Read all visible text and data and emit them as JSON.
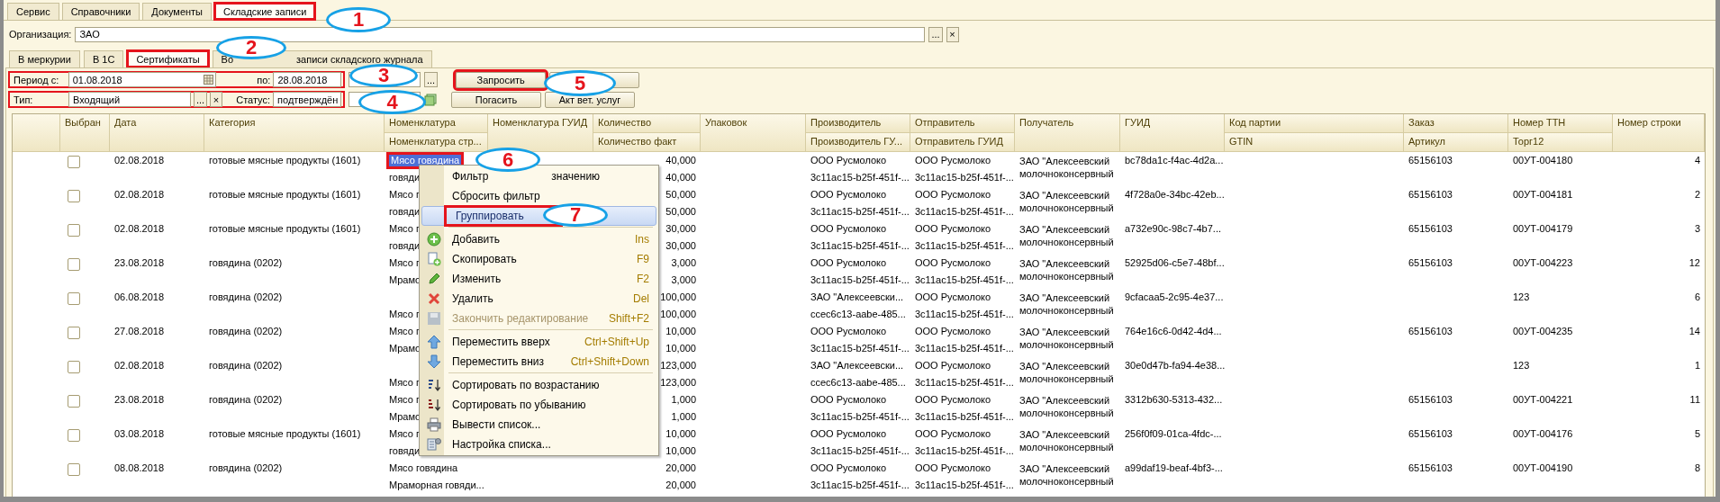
{
  "top_tabs": [
    {
      "label": "Сервис",
      "selected": false,
      "highlighted": false
    },
    {
      "label": "Справочники",
      "selected": false,
      "highlighted": false
    },
    {
      "label": "Документы",
      "selected": false,
      "highlighted": false
    },
    {
      "label": "Складские записи",
      "selected": true,
      "highlighted": true
    }
  ],
  "organization": {
    "label": "Организация:",
    "value": "ЗАО",
    "choose_button": "...",
    "clear_button": "×"
  },
  "sub_tabs": [
    {
      "label": "В меркурии",
      "selected": false,
      "highlighted": false
    },
    {
      "label": "В 1С",
      "selected": false,
      "highlighted": false
    },
    {
      "label": "Сертификаты",
      "selected": true,
      "highlighted": true
    },
    {
      "label": "Во",
      "label_end": "записи складского журнала",
      "selected": false,
      "highlighted": false
    }
  ],
  "period_filter": {
    "highlighted": true,
    "from_label": "Период с:",
    "from_value": "01.08.2018",
    "to_label": "по:",
    "to_value": "28.08.2018",
    "extra_button": "..."
  },
  "type_filter": {
    "highlighted": true,
    "type_label": "Тип:",
    "type_value": "Входящий",
    "choose_button": "...",
    "clear_button": "×",
    "status_label": "Статус:",
    "status_value": "подтверждён"
  },
  "buttons_row_1": [
    {
      "kind": "text",
      "label": "Запросить",
      "highlighted": true
    },
    {
      "kind": "blank",
      "highlighted": false
    }
  ],
  "buttons_row_2": [
    {
      "kind": "text",
      "label": "Погасить",
      "highlighted": false
    },
    {
      "kind": "text",
      "label": "Акт вет. услуг",
      "highlighted": false
    }
  ],
  "table": {
    "columns": [
      {
        "title": "Выбран"
      },
      {
        "title": "Дата"
      },
      {
        "title": "Категория"
      },
      {
        "title": "Номенклатура",
        "subtitle": "Номенклатура стр..."
      },
      {
        "title": "Номенклатура ГУИД"
      },
      {
        "title": "Количество",
        "subtitle": "Количество факт"
      },
      {
        "title": "Упаковок"
      },
      {
        "title": "Производитель",
        "subtitle": "Производитель ГУ..."
      },
      {
        "title": "Отправитель",
        "subtitle": "Отправитель ГУИД"
      },
      {
        "title": "Получатель"
      },
      {
        "title": "ГУИД"
      },
      {
        "title": "Код партии",
        "subtitle": "GTIN"
      },
      {
        "title": "Заказ",
        "subtitle": "Артикул"
      },
      {
        "title": "Номер ТТН",
        "subtitle": "Торг12"
      },
      {
        "title": "Номер строки"
      }
    ],
    "rows": [
      {
        "checked": false,
        "date": "02.08.2018",
        "category": "готовые мясные продукты (1601)",
        "nomenclature": {
          "top": "Мясо говядина",
          "bottom": "говяди",
          "selected": true,
          "highlighted": true
        },
        "quantity": [
          "40,000",
          "40,000"
        ],
        "producer": [
          "ООО Русмолоко",
          "3c11ac15-b25f-451f-..."
        ],
        "sender": [
          "ООО Русмолоко",
          "3c11ac15-b25f-451f-..."
        ],
        "recipient": "ЗАО \"Алексеевский молочноконсервный",
        "guid": "bc78da1c-f4ac-4d2a...",
        "order": "65156103",
        "ttn": "00УТ-004180",
        "line_no": "4"
      },
      {
        "checked": false,
        "date": "02.08.2018",
        "category": "готовые мясные продукты (1601)",
        "nomenclature": {
          "top": "Мясо г",
          "bottom": "говяди",
          "selected": false,
          "highlighted": false
        },
        "quantity": [
          "50,000",
          "50,000"
        ],
        "producer": [
          "ООО Русмолоко",
          "3c11ac15-b25f-451f-..."
        ],
        "sender": [
          "ООО Русмолоко",
          "3c11ac15-b25f-451f-..."
        ],
        "recipient": "ЗАО \"Алексеевский молочноконсервный",
        "guid": "4f728a0e-34bc-42eb...",
        "order": "65156103",
        "ttn": "00УТ-004181",
        "line_no": "2"
      },
      {
        "checked": false,
        "date": "02.08.2018",
        "category": "готовые мясные продукты (1601)",
        "nomenclature": {
          "top": "Мясо г",
          "bottom": "говяди",
          "selected": false,
          "highlighted": false
        },
        "quantity": [
          "30,000",
          "30,000"
        ],
        "producer": [
          "ООО Русмолоко",
          "3c11ac15-b25f-451f-..."
        ],
        "sender": [
          "ООО Русмолоко",
          "3c11ac15-b25f-451f-..."
        ],
        "recipient": "ЗАО \"Алексеевский молочноконсервный",
        "guid": "a732e90c-98c7-4b7...",
        "order": "65156103",
        "ttn": "00УТ-004179",
        "line_no": "3"
      },
      {
        "checked": false,
        "date": "23.08.2018",
        "category": "говядина (0202)",
        "nomenclature": {
          "top": "Мясо г",
          "bottom": "Мрамо",
          "selected": false,
          "highlighted": false
        },
        "quantity": [
          "3,000",
          "3,000"
        ],
        "producer": [
          "ООО Русмолоко",
          "3c11ac15-b25f-451f-..."
        ],
        "sender": [
          "ООО Русмолоко",
          "3c11ac15-b25f-451f-..."
        ],
        "recipient": "ЗАО \"Алексеевский молочноконсервный",
        "guid": "52925d06-c5e7-48bf...",
        "order": "65156103",
        "ttn": "00УТ-004223",
        "line_no": "12"
      },
      {
        "checked": false,
        "date": "06.08.2018",
        "category": "говядина (0202)",
        "nomenclature": {
          "bottom": "Мясо г",
          "selected": false,
          "highlighted": false
        },
        "quantity": [
          "100,000",
          "100,000"
        ],
        "producer": [
          "ЗАО \"Алексеевски...",
          "ccec6c13-aabe-485..."
        ],
        "sender": [
          "ООО Русмолоко",
          "3c11ac15-b25f-451f-..."
        ],
        "recipient": "ЗАО \"Алексеевский молочноконсервный",
        "guid": "9cfacaa5-2c95-4e37...",
        "ttn": "123",
        "line_no": "6"
      },
      {
        "checked": false,
        "date": "27.08.2018",
        "category": "говядина (0202)",
        "nomenclature": {
          "top": "Мясо г",
          "bottom": "Мрамо",
          "selected": false,
          "highlighted": false
        },
        "quantity": [
          "10,000",
          "10,000"
        ],
        "producer": [
          "ООО Русмолоко",
          "3c11ac15-b25f-451f-..."
        ],
        "sender": [
          "ООО Русмолоко",
          "3c11ac15-b25f-451f-..."
        ],
        "recipient": "ЗАО \"Алексеевский молочноконсервный",
        "guid": "764e16c6-0d42-4d4...",
        "order": "65156103",
        "ttn": "00УТ-004235",
        "line_no": "14"
      },
      {
        "checked": false,
        "date": "02.08.2018",
        "category": "говядина (0202)",
        "nomenclature": {
          "bottom": "Мясо г",
          "selected": false,
          "highlighted": false
        },
        "quantity": [
          "123,000",
          "123,000"
        ],
        "producer": [
          "ЗАО \"Алексеевски...",
          "ccec6c13-aabe-485..."
        ],
        "sender": [
          "ООО Русмолоко",
          "3c11ac15-b25f-451f-..."
        ],
        "recipient": "ЗАО \"Алексеевский молочноконсервный",
        "guid": "30e0d47b-fa94-4e38...",
        "ttn": "123",
        "line_no": "1"
      },
      {
        "checked": false,
        "date": "23.08.2018",
        "category": "говядина (0202)",
        "nomenclature": {
          "top": "Мясо г",
          "bottom": "Мрамо",
          "selected": false,
          "highlighted": false
        },
        "quantity": [
          "1,000",
          "1,000"
        ],
        "producer": [
          "ООО Русмолоко",
          "3c11ac15-b25f-451f-..."
        ],
        "sender": [
          "ООО Русмолоко",
          "3c11ac15-b25f-451f-..."
        ],
        "recipient": "ЗАО \"Алексеевский молочноконсервный",
        "guid": "3312b630-5313-432...",
        "order": "65156103",
        "ttn": "00УТ-004221",
        "line_no": "11"
      },
      {
        "checked": false,
        "date": "03.08.2018",
        "category": "готовые мясные продукты (1601)",
        "nomenclature": {
          "top": "Мясо г",
          "bottom": "говяди",
          "selected": false,
          "highlighted": false
        },
        "quantity": [
          "10,000",
          "10,000"
        ],
        "producer": [
          "ООО Русмолоко",
          "3c11ac15-b25f-451f-..."
        ],
        "sender": [
          "ООО Русмолоко",
          "3c11ac15-b25f-451f-..."
        ],
        "recipient": "ЗАО \"Алексеевский молочноконсервный",
        "guid": "256f0f09-01ca-4fdc-...",
        "order": "65156103",
        "ttn": "00УТ-004176",
        "line_no": "5"
      },
      {
        "checked": false,
        "date": "08.08.2018",
        "category": "говядина (0202)",
        "nomenclature": {
          "top": "Мясо говядина",
          "bottom": "Мраморная говяди...",
          "selected": false,
          "highlighted": false
        },
        "quantity": [
          "20,000",
          "20,000"
        ],
        "producer": [
          "ООО Русмолоко",
          "3c11ac15-b25f-451f-..."
        ],
        "sender": [
          "ООО Русмолоко",
          "3c11ac15-b25f-451f-..."
        ],
        "recipient": "ЗАО \"Алексеевский молочноконсервный",
        "guid": "a99daf19-beaf-4bf3-...",
        "order": "65156103",
        "ttn": "00УТ-004190",
        "line_no": "8"
      }
    ]
  },
  "context_menu": {
    "items": [
      {
        "kind": "item",
        "label": "Фильтр",
        "label_end": "значению",
        "selected": false,
        "highlighted": false,
        "disabled": false
      },
      {
        "kind": "item",
        "label": "Сбросить фильтр",
        "selected": false,
        "highlighted": false,
        "disabled": false
      },
      {
        "kind": "item",
        "label": "Группировать",
        "selected": true,
        "highlighted": true,
        "disabled": false
      },
      {
        "kind": "separator"
      },
      {
        "kind": "item",
        "label": "Добавить",
        "shortcut": "Ins",
        "selected": false,
        "highlighted": false,
        "disabled": false
      },
      {
        "kind": "item",
        "label": "Скопировать",
        "shortcut": "F9",
        "selected": false,
        "highlighted": false,
        "disabled": false
      },
      {
        "kind": "item",
        "label": "Изменить",
        "shortcut": "F2",
        "selected": false,
        "highlighted": false,
        "disabled": false
      },
      {
        "kind": "item",
        "label": "Удалить",
        "shortcut": "Del",
        "selected": false,
        "highlighted": false,
        "disabled": false
      },
      {
        "kind": "item",
        "label": "Закончить редактирование",
        "shortcut": "Shift+F2",
        "selected": false,
        "highlighted": false,
        "disabled": true
      },
      {
        "kind": "separator"
      },
      {
        "kind": "item",
        "label": "Переместить вверх",
        "shortcut": "Ctrl+Shift+Up",
        "selected": false,
        "highlighted": false,
        "disabled": false
      },
      {
        "kind": "item",
        "label": "Переместить вниз",
        "shortcut": "Ctrl+Shift+Down",
        "selected": false,
        "highlighted": false,
        "disabled": false
      },
      {
        "kind": "separator"
      },
      {
        "kind": "item",
        "label": "Сортировать по возрастанию",
        "selected": false,
        "highlighted": false,
        "disabled": false
      },
      {
        "kind": "item",
        "label": "Сортировать по убыванию",
        "selected": false,
        "highlighted": false,
        "disabled": false
      },
      {
        "kind": "item",
        "label": "Вывести список...",
        "selected": false,
        "highlighted": false,
        "disabled": false
      },
      {
        "kind": "item",
        "label": "Настройка списка...",
        "selected": false,
        "highlighted": false,
        "disabled": false
      }
    ]
  },
  "callouts": [
    {
      "number": "1"
    },
    {
      "number": "2"
    },
    {
      "number": "3"
    },
    {
      "number": "4"
    },
    {
      "number": "5"
    },
    {
      "number": "6"
    },
    {
      "number": "7"
    }
  ]
}
